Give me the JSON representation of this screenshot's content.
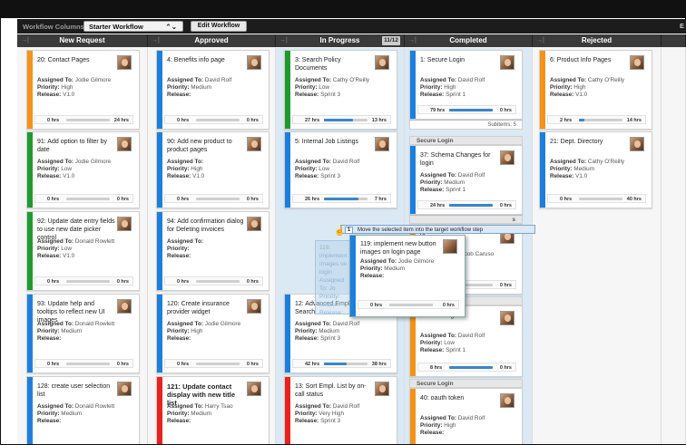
{
  "toolbar": {
    "workflow_label": "Workflow Columns:",
    "workflow_value": "Starter Workflow",
    "select_chevron": "⌃⌄",
    "edit_button": "Edit Workflow",
    "more": "E"
  },
  "columns": [
    {
      "arrow": "→|",
      "title": "New Request"
    },
    {
      "arrow": "→|",
      "title": "Approved"
    },
    {
      "arrow": "→|",
      "title": "In Progress",
      "count": "11/12"
    },
    {
      "arrow": "→|",
      "title": "Completed"
    },
    {
      "arrow": "→|",
      "title": "Rejected"
    }
  ],
  "labels": {
    "assigned": "Assigned To:",
    "priority": "Priority:",
    "release": "Release:"
  },
  "colors": {
    "orange": "#f39318",
    "blue": "#1d7fdc",
    "green": "#1f9a2e",
    "red": "#e8221d",
    "highlight": "#dbe9f5"
  },
  "cards": [
    {
      "title": "20: Contact Pages",
      "assigned": "Jodie Gilmore",
      "priority": "High",
      "release": "V1.0",
      "left": "0 hrs",
      "right": "24 hrs",
      "progress": 0
    },
    {
      "title": "91: Add option to filter by date",
      "assigned": "Jodie Gilmore",
      "priority": "Low",
      "release": "V1.0",
      "left": "0 hrs",
      "right": "0 hrs",
      "progress": 0
    },
    {
      "title": "92: Update date entry fields to use new date picker control",
      "assigned": "Donald Rowlett",
      "priority": "Low",
      "release": "V1.0",
      "left": "0 hrs",
      "right": "0 hrs",
      "progress": 0
    },
    {
      "title": "93: Update help and tooltips to reflect new UI images",
      "assigned": "Donald Rowlett",
      "priority": "Medium",
      "release": "",
      "left": "0 hrs",
      "right": "0 hrs",
      "progress": 0
    },
    {
      "title": "128: create user selection list",
      "assigned": "Donald Rowlett",
      "priority": "Medium",
      "release": "",
      "left": "",
      "right": "",
      "progress": 0
    },
    {
      "title": "4: Benefits info page",
      "assigned": "David Rolf",
      "priority": "Medium",
      "release": "",
      "left": "0 hrs",
      "right": "0 hrs",
      "progress": 0
    },
    {
      "title": "90: Add new product to product pages",
      "assigned": "",
      "priority": "High",
      "release": "V1.0",
      "left": "0 hrs",
      "right": "0 hrs",
      "progress": 0
    },
    {
      "title": "94: Add confirmation dialog for Deleting invoices",
      "assigned": "",
      "priority": "",
      "release": "",
      "left": "0 hrs",
      "right": "0 hrs",
      "progress": 0
    },
    {
      "title": "120: Create insurance provider widget",
      "assigned": "Jodie Gilmore",
      "priority": "High",
      "release": "",
      "left": "0 hrs",
      "right": "0 hrs",
      "progress": 0
    },
    {
      "title": "121: Update contact display with new title list",
      "assigned": "Harry Tsao",
      "priority": "Medium",
      "release": "",
      "left": "",
      "right": "",
      "progress": 0
    },
    {
      "title": "3: Search Policy Documents",
      "assigned": "Cathy O'Reilly",
      "priority": "Low",
      "release": "Sprint 3",
      "left": "27 hrs",
      "right": "13 hrs",
      "progress": 0.67
    },
    {
      "title": "5: Internal Job Listings",
      "assigned": "David Rolf",
      "priority": "Low",
      "release": "Sprint 3",
      "left": "26 hrs",
      "right": "7 hrs",
      "progress": 0.79
    },
    {
      "title": "12: Advanced Empl. Search",
      "assigned": "David Rolf",
      "priority": "Medium",
      "release": "Sprint 3",
      "left": "42 hrs",
      "right": "38 hrs",
      "progress": 0.52
    },
    {
      "title": "13: Sort Empl. List by on-call status",
      "assigned": "David Rolf",
      "priority": "Very High",
      "release": "Sprint 3",
      "left": "",
      "right": "",
      "progress": 0
    },
    {
      "title": "1: Secure Login",
      "assigned": "David Rolf",
      "priority": "High",
      "release": "Sprint 1",
      "left": "79 hrs",
      "right": "0 hrs",
      "progress": 1
    },
    {
      "title": "37: Schema Changes for login",
      "assigned": "David Rolf",
      "priority": "Medium",
      "release": "Sprint 1",
      "left": "24 hrs",
      "right": "0 hrs",
      "progress": 1
    },
    {
      "title": "ge",
      "assigned": "Jacob Caruso",
      "priority": "y High",
      "release": "nt 1",
      "left": "",
      "right": "0 hrs",
      "progress": 0
    },
    {
      "title": "39: Hashing",
      "assigned": "David Rolf",
      "priority": "Low",
      "release": "Sprint 1",
      "left": "8 hrs",
      "right": "0 hrs",
      "progress": 1
    },
    {
      "title": "40: oauth token",
      "assigned": "David Rolf",
      "priority": "High",
      "release": "",
      "left": "",
      "right": "",
      "progress": 0
    },
    {
      "title": "6: Product Info Pages",
      "assigned": "Cathy O'Reilly",
      "priority": "High",
      "release": "V1.0",
      "left": "2 hrs",
      "right": "14 hrs",
      "progress": 0.12
    },
    {
      "title": "21: Dept. Directory",
      "assigned": "Cathy O'Reilly",
      "priority": "Medium",
      "release": "V1.0",
      "left": "0 hrs",
      "right": "40 hrs",
      "progress": 0
    }
  ],
  "completed_extras": {
    "subitems": "Subitems: 5",
    "section1": "Secure Login",
    "section2_fragment": "s",
    "section3": "Secure Login",
    "section4": "Secure Login"
  },
  "tooltip": {
    "number": "1",
    "text": "Move the selected item into the target workflow step"
  },
  "drag_card": {
    "title": "119: implement new button images on login page",
    "assigned": "Jodie Gilmore",
    "priority": "Medium",
    "release": "",
    "left": "0 hrs",
    "right": "0 hrs"
  },
  "ghost_text": "119: implement images on login Assigned To: Jo Priority: Mediu Release:"
}
